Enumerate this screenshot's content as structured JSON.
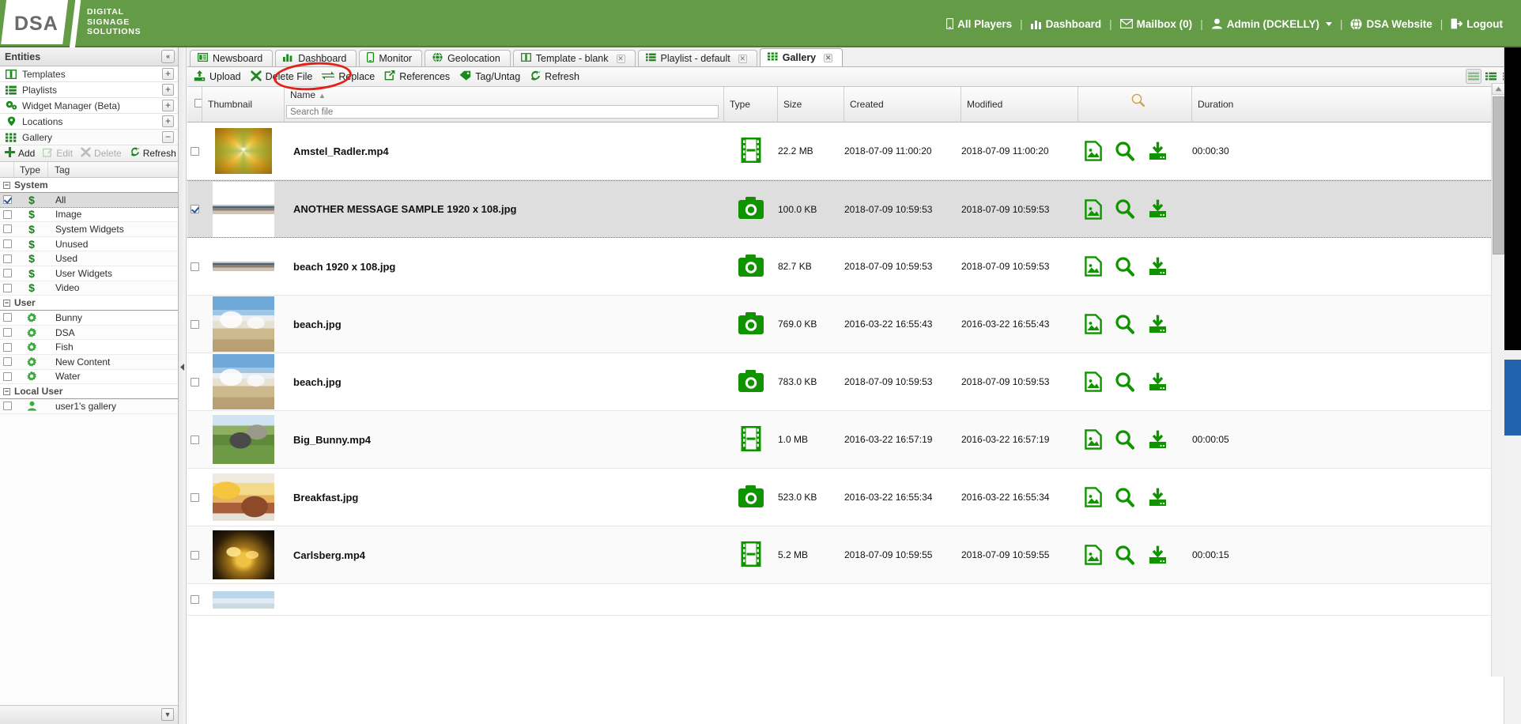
{
  "brand": {
    "logo_text": "DSA",
    "tagline_line1": "DIGITAL",
    "tagline_line2": "SIGNAGE",
    "tagline_line3": "SOLUTIONS",
    "green": "#639b46"
  },
  "topnav": {
    "items": [
      {
        "label": "All Players",
        "icon": "player-icon"
      },
      {
        "label": "Dashboard",
        "icon": "chart-bars-icon"
      },
      {
        "label": "Mailbox (0)",
        "icon": "envelope-icon"
      },
      {
        "label": "Admin (DCKELLY)",
        "icon": "user-icon",
        "caret": true
      },
      {
        "label": "DSA Website",
        "icon": "globe-icon"
      },
      {
        "label": "Logout",
        "icon": "logout-icon"
      }
    ],
    "separator": "|"
  },
  "sidebar": {
    "title": "Entities",
    "collapse_label": "«",
    "entities": [
      {
        "label": "Templates",
        "icon": "template-icon",
        "action": "+"
      },
      {
        "label": "Playlists",
        "icon": "playlist-icon",
        "action": "+"
      },
      {
        "label": "Widget Manager (Beta)",
        "icon": "widget-icon",
        "action": "+"
      },
      {
        "label": "Locations",
        "icon": "location-pin-icon",
        "action": "+"
      },
      {
        "label": "Gallery",
        "icon": "gallery-grid-icon",
        "action": "−"
      }
    ],
    "gallery_toolbar": [
      {
        "label": "Add",
        "icon": "plus-icon",
        "disabled": false
      },
      {
        "label": "Edit",
        "icon": "edit-pencil-icon",
        "disabled": true
      },
      {
        "label": "Delete",
        "icon": "delete-x-icon",
        "disabled": true
      },
      {
        "label": "Refresh",
        "icon": "refresh-icon",
        "disabled": false
      }
    ],
    "tag_table": {
      "col_type": "Type",
      "col_tag": "Tag",
      "groups": [
        {
          "name": "System",
          "rows": [
            {
              "tag": "All",
              "icon": "dollar-icon",
              "checked": true
            },
            {
              "tag": "Image",
              "icon": "dollar-icon",
              "checked": false
            },
            {
              "tag": "System Widgets",
              "icon": "dollar-icon",
              "checked": false
            },
            {
              "tag": "Unused",
              "icon": "dollar-icon",
              "checked": false
            },
            {
              "tag": "Used",
              "icon": "dollar-icon",
              "checked": false
            },
            {
              "tag": "User Widgets",
              "icon": "dollar-icon",
              "checked": false
            },
            {
              "tag": "Video",
              "icon": "dollar-icon",
              "checked": false
            }
          ]
        },
        {
          "name": "User",
          "rows": [
            {
              "tag": "Bunny",
              "icon": "gear-icon",
              "checked": false
            },
            {
              "tag": "DSA",
              "icon": "gear-icon",
              "checked": false
            },
            {
              "tag": "Fish",
              "icon": "gear-icon",
              "checked": false
            },
            {
              "tag": "New Content",
              "icon": "gear-icon",
              "checked": false
            },
            {
              "tag": "Water",
              "icon": "gear-icon",
              "checked": false
            }
          ]
        },
        {
          "name": "Local User",
          "rows": [
            {
              "tag": "user1's gallery",
              "icon": "person-icon",
              "checked": false
            }
          ]
        }
      ]
    }
  },
  "tabs": [
    {
      "label": "Newsboard",
      "icon": "newsboard-icon",
      "active": false,
      "closable": false
    },
    {
      "label": "Dashboard",
      "icon": "chart-bars-icon",
      "active": false,
      "closable": false
    },
    {
      "label": "Monitor",
      "icon": "monitor-icon",
      "active": false,
      "closable": false
    },
    {
      "label": "Geolocation",
      "icon": "globe-icon",
      "active": false,
      "closable": false
    },
    {
      "label": "Template - blank",
      "icon": "template-icon",
      "active": false,
      "closable": true
    },
    {
      "label": "Playlist - default",
      "icon": "playlist-icon",
      "active": false,
      "closable": true
    },
    {
      "label": "Gallery",
      "icon": "gallery-grid-icon",
      "active": true,
      "closable": true
    }
  ],
  "toolbar": {
    "commands": [
      {
        "label": "Upload",
        "icon": "upload-icon"
      },
      {
        "label": "Delete File",
        "icon": "delete-x-icon"
      },
      {
        "label": "Replace",
        "icon": "replace-arrows-icon"
      },
      {
        "label": "References",
        "icon": "external-link-icon",
        "annotated": true
      },
      {
        "label": "Tag/Untag",
        "icon": "tag-icon"
      },
      {
        "label": "Refresh",
        "icon": "refresh-icon"
      }
    ],
    "view_modes": [
      {
        "name": "list-view-icon",
        "selected": true
      },
      {
        "name": "detail-view-icon",
        "selected": false
      },
      {
        "name": "thumbnail-view-icon",
        "selected": false
      }
    ],
    "annotation": {
      "shape": "ellipse",
      "color": "#e32119",
      "target": "References"
    }
  },
  "grid": {
    "columns": [
      {
        "key": "check",
        "label": ""
      },
      {
        "key": "thumbnail",
        "label": "Thumbnail"
      },
      {
        "key": "name",
        "label": "Name",
        "sorted": "asc",
        "sort_glyph": "▲"
      },
      {
        "key": "type",
        "label": "Type"
      },
      {
        "key": "size",
        "label": "Size"
      },
      {
        "key": "created",
        "label": "Created"
      },
      {
        "key": "modified",
        "label": "Modified"
      },
      {
        "key": "actions",
        "label": "",
        "icon": "search-magnifier-icon"
      },
      {
        "key": "duration",
        "label": "Duration"
      }
    ],
    "search_placeholder": "Search file",
    "search_value": "",
    "row_actions": [
      {
        "name": "preview-image-icon"
      },
      {
        "name": "inspect-magnifier-icon"
      },
      {
        "name": "download-icon"
      }
    ],
    "rows": [
      {
        "name": "Amstel_Radler.mp4",
        "type": "video",
        "type_icon": "film-strip-icon",
        "size": "22.2 MB",
        "created": "2018-07-09 11:00:20",
        "modified": "2018-07-09 11:00:20",
        "duration": "00:00:30",
        "selected": false,
        "thumb": "thumb-amstel"
      },
      {
        "name": "ANOTHER MESSAGE SAMPLE 1920 x 108.jpg",
        "type": "image",
        "type_icon": "camera-icon",
        "size": "100.0 KB",
        "created": "2018-07-09 10:59:53",
        "modified": "2018-07-09 10:59:53",
        "duration": "",
        "selected": true,
        "thumb": "thumb-strip"
      },
      {
        "name": "beach 1920 x 108.jpg",
        "type": "image",
        "type_icon": "camera-icon",
        "size": "82.7 KB",
        "created": "2018-07-09 10:59:53",
        "modified": "2018-07-09 10:59:53",
        "duration": "",
        "selected": false,
        "thumb": "thumb-strip"
      },
      {
        "name": "beach.jpg",
        "type": "image",
        "type_icon": "camera-icon",
        "size": "769.0 KB",
        "created": "2016-03-22 16:55:43",
        "modified": "2016-03-22 16:55:43",
        "duration": "",
        "selected": false,
        "thumb": "thumb-beach"
      },
      {
        "name": "beach.jpg",
        "type": "image",
        "type_icon": "camera-icon",
        "size": "783.0 KB",
        "created": "2018-07-09 10:59:53",
        "modified": "2018-07-09 10:59:53",
        "duration": "",
        "selected": false,
        "thumb": "thumb-beach"
      },
      {
        "name": "Big_Bunny.mp4",
        "type": "video",
        "type_icon": "film-strip-icon",
        "size": "1.0 MB",
        "created": "2016-03-22 16:57:19",
        "modified": "2016-03-22 16:57:19",
        "duration": "00:00:05",
        "selected": false,
        "thumb": "thumb-bunny"
      },
      {
        "name": "Breakfast.jpg",
        "type": "image",
        "type_icon": "camera-icon",
        "size": "523.0 KB",
        "created": "2016-03-22 16:55:34",
        "modified": "2016-03-22 16:55:34",
        "duration": "",
        "selected": false,
        "thumb": "thumb-breakfast"
      },
      {
        "name": "Carlsberg.mp4",
        "type": "video",
        "type_icon": "film-strip-icon",
        "size": "5.2 MB",
        "created": "2018-07-09 10:59:55",
        "modified": "2018-07-09 10:59:55",
        "duration": "00:00:15",
        "selected": false,
        "thumb": "thumb-carlsberg"
      }
    ]
  }
}
